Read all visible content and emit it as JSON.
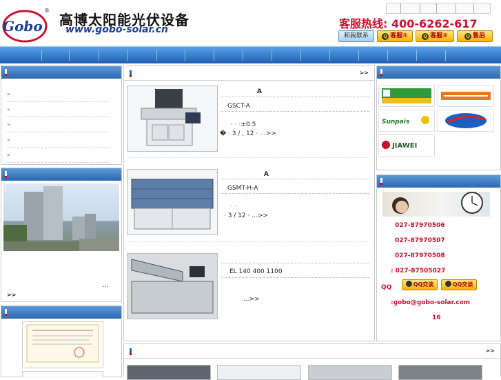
{
  "header": {
    "logo_text": "Gobo",
    "logo_reg": "®",
    "brand_cn": "高博太阳能光伏设备",
    "brand_url": "www.gobo-solar.cn",
    "hotline": "客服热线: 400-6262-617",
    "buttons": {
      "contact": "和我联系",
      "service1": "客服①",
      "service2": "客服②",
      "after_sales": "售后"
    }
  },
  "more_label": ">>",
  "left": {
    "menu_arrow": "»",
    "ellipsis": "...",
    "more": ">>"
  },
  "products": [
    {
      "title": "A",
      "model": "GSCT-A",
      "spec_line": "·                    ·               :±0.5",
      "spec_line2": "�    ·           3 /  ,   12           ·         ...>>"
    },
    {
      "title": "A",
      "model": "GSMT-H-A",
      "spec_line": "·                                    ·",
      "spec_line2": "·                  3 /    12          ·         ...>>"
    },
    {
      "title": "",
      "model": "EL 140  400  1100",
      "spec_line": "",
      "spec_line2": "...>>"
    }
  ],
  "partners": [
    {
      "name": "partner-1"
    },
    {
      "name": "partner-2"
    },
    {
      "name": "Sunpais"
    },
    {
      "name": "partner-4"
    },
    {
      "name": "JIAWEI"
    }
  ],
  "contact": {
    "phones": [
      "027-87970506",
      "027-87970507",
      "027-87970508",
      ": 027-87505027"
    ],
    "qq_label": "QQ",
    "qq_button": "QQ交谈",
    "email": ":gobo@gobo-solar.com",
    "hours": "16"
  },
  "colors": {
    "nav_top": "#5aa0e6",
    "nav_bottom": "#1d5fb5",
    "accent_red": "#c8102e"
  }
}
